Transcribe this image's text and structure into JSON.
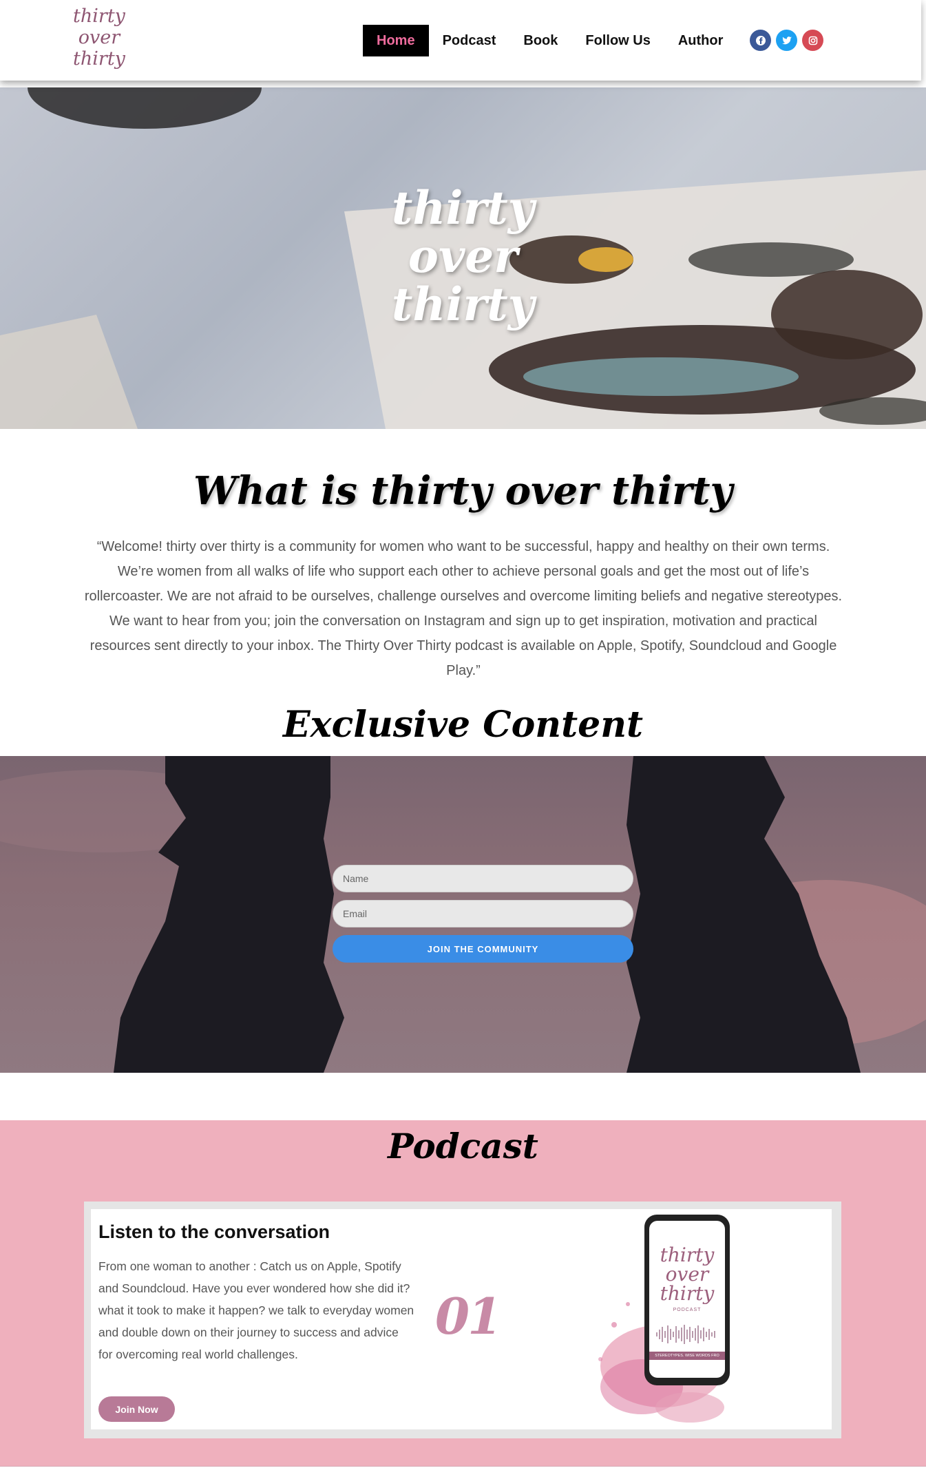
{
  "header": {
    "logo": "thirty over thirty",
    "nav": [
      "Home",
      "Podcast",
      "Book",
      "Follow Us",
      "Author"
    ],
    "active_nav": "Home",
    "socials": [
      {
        "name": "facebook-icon",
        "color": "#3b5998"
      },
      {
        "name": "twitter-icon",
        "color": "#1da1f2"
      },
      {
        "name": "instagram-icon",
        "color": "#d64a55"
      }
    ]
  },
  "hero": {
    "line1": "thirty",
    "line2": "over",
    "line3": "thirty"
  },
  "about": {
    "title": "What is thirty over thirty",
    "text": "“Welcome! thirty over thirty is a community for women who want to be successful, happy and healthy on their own terms. We’re women from all walks of life who support each other to achieve personal goals and get the most out of life’s rollercoaster. We are not afraid to be ourselves, challenge ourselves and overcome limiting beliefs and negative stereotypes. We want to hear from you; join the conversation on Instagram and sign up to get inspiration, motivation and practical resources sent directly to your inbox. The Thirty Over Thirty podcast is available on Apple, Spotify, Soundcloud and Google Play.”"
  },
  "exclusive": {
    "title": "Exclusive Content",
    "name_placeholder": "Name",
    "email_placeholder": "Email",
    "button": "JOIN THE COMMUNITY"
  },
  "podcast": {
    "title": "Podcast",
    "card_heading": "Listen to the conversation",
    "card_text": "From one woman to another : Catch us on Apple, Spotify and Soundcloud. Have you ever wondered how she did it? what it took to make it happen? we talk to everyday women and double down on their journey to success and advice for overcoming real world challenges.",
    "button": "Join Now",
    "number": "01",
    "phone_title": "thirty over thirty",
    "phone_sub": "PODCAST",
    "phone_tag": "STEREOTYPES. WISE WORDS FRO"
  },
  "colors": {
    "accent_pink": "#ee6c9d",
    "podcast_bg": "#efb0bd",
    "button_blue": "#3a8de6",
    "join_now": "#b87a97"
  }
}
